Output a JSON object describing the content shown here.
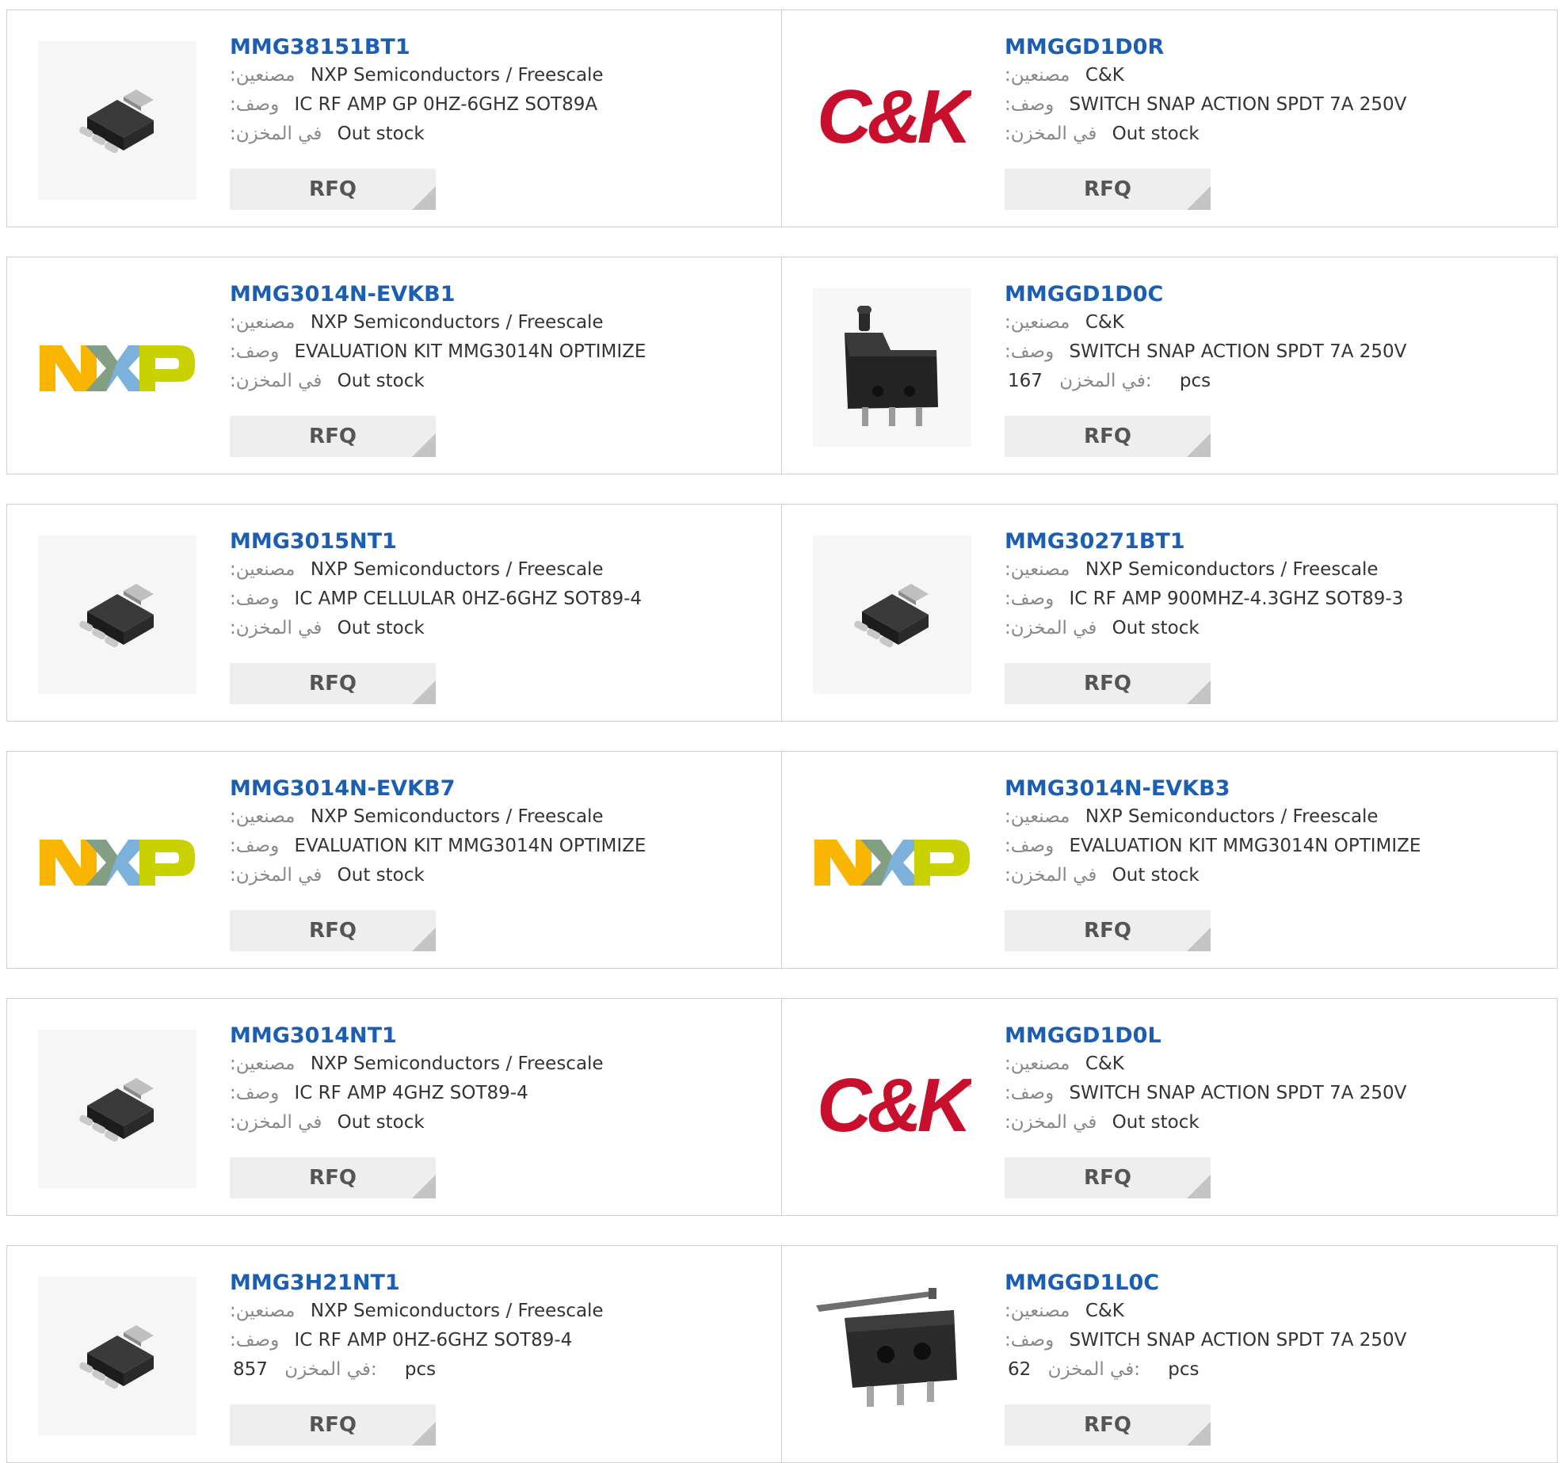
{
  "labels": {
    "manufacturer": ":مصنعين",
    "description": ":وصف",
    "stock": ":في المخزن",
    "stock_qty": "في المخزن:",
    "unit": "pcs",
    "rfq": "RFQ"
  },
  "products": [
    {
      "part": "MMG38151BT1",
      "manufacturer": "NXP Semiconductors / Freescale",
      "description": "IC RF AMP GP 0HZ-6GHZ SOT89A",
      "stock": "Out stock",
      "image": "sot89-chip-icon"
    },
    {
      "part": "MMGGD1D0R",
      "manufacturer": "C&K",
      "description": "SWITCH SNAP ACTION SPDT 7A 250V",
      "stock": "Out stock",
      "image": "ck-logo"
    },
    {
      "part": "MMG3014N-EVKB1",
      "manufacturer": "NXP Semiconductors / Freescale",
      "description": "EVALUATION KIT MMG3014N OPTIMIZE",
      "stock": "Out stock",
      "image": "nxp-logo"
    },
    {
      "part": "MMGGD1D0C",
      "manufacturer": "C&K",
      "description": "SWITCH SNAP ACTION SPDT 7A 250V",
      "stock_qty": "167",
      "image": "snap-switch-plunger-icon"
    },
    {
      "part": "MMG3015NT1",
      "manufacturer": "NXP Semiconductors / Freescale",
      "description": "IC AMP CELLULAR 0HZ-6GHZ SOT89-4",
      "stock": "Out stock",
      "image": "sot89-chip-icon"
    },
    {
      "part": "MMG30271BT1",
      "manufacturer": "NXP Semiconductors / Freescale",
      "description": "IC RF AMP 900MHZ-4.3GHZ SOT89-3",
      "stock": "Out stock",
      "image": "sot89-chip-icon"
    },
    {
      "part": "MMG3014N-EVKB7",
      "manufacturer": "NXP Semiconductors / Freescale",
      "description": "EVALUATION KIT MMG3014N OPTIMIZE",
      "stock": "Out stock",
      "image": "nxp-logo"
    },
    {
      "part": "MMG3014N-EVKB3",
      "manufacturer": "NXP Semiconductors / Freescale",
      "description": "EVALUATION KIT MMG3014N OPTIMIZE",
      "stock": "Out stock",
      "image": "nxp-logo"
    },
    {
      "part": "MMG3014NT1",
      "manufacturer": "NXP Semiconductors / Freescale",
      "description": "IC RF AMP 4GHZ SOT89-4",
      "stock": "Out stock",
      "image": "sot89-chip-icon"
    },
    {
      "part": "MMGGD1D0L",
      "manufacturer": "C&K",
      "description": "SWITCH SNAP ACTION SPDT 7A 250V",
      "stock": "Out stock",
      "image": "ck-logo"
    },
    {
      "part": "MMG3H21NT1",
      "manufacturer": "NXP Semiconductors / Freescale",
      "description": "IC RF AMP 0HZ-6GHZ SOT89-4",
      "stock_qty": "857",
      "image": "sot89-chip-icon"
    },
    {
      "part": "MMGGD1L0C",
      "manufacturer": "C&K",
      "description": "SWITCH SNAP ACTION SPDT 7A 250V",
      "stock_qty": "62",
      "image": "snap-switch-lever-icon"
    }
  ],
  "colors": {
    "link": "#1a5fb4",
    "label": "#888888",
    "button_bg": "#eeeeee",
    "border": "#cfcfcf",
    "ck_red": "#c8102e",
    "nxp_orange": "#f9b500",
    "nxp_blue": "#7bb1db",
    "nxp_green": "#c9d200"
  }
}
